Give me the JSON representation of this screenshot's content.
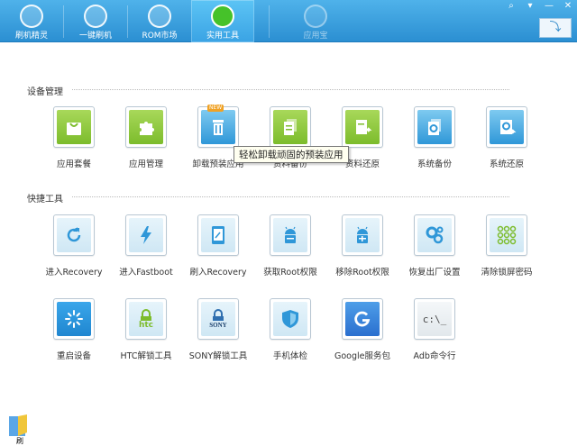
{
  "tabs": [
    {
      "label": "刷机精灵",
      "icon": "flash-sprite-icon"
    },
    {
      "label": "一键刷机",
      "icon": "play-icon"
    },
    {
      "label": "ROM市场",
      "icon": "android-icon"
    },
    {
      "label": "实用工具",
      "icon": "grid-icon"
    },
    {
      "label": "应用宝",
      "icon": "app-store-icon"
    }
  ],
  "window": {
    "btn_feedback": "⌕",
    "btn_menu": "▾",
    "btn_min": "—",
    "btn_close": "✕",
    "btn_back": "⤵"
  },
  "sections": {
    "device": "设备管理",
    "quick": "快捷工具"
  },
  "device_items": [
    {
      "label": "应用套餐"
    },
    {
      "label": "应用管理"
    },
    {
      "label": "卸载预装应用",
      "badge": "NEW"
    },
    {
      "label": "资料备份"
    },
    {
      "label": "资料还原"
    },
    {
      "label": "系统备份"
    },
    {
      "label": "系统还原"
    }
  ],
  "quick_items": [
    {
      "label": "进入Recovery"
    },
    {
      "label": "进入Fastboot"
    },
    {
      "label": "刷入Recovery"
    },
    {
      "label": "获取Root权限"
    },
    {
      "label": "移除Root权限"
    },
    {
      "label": "恢复出厂设置"
    },
    {
      "label": "清除锁屏密码"
    },
    {
      "label": "重启设备"
    },
    {
      "label": "HTC解锁工具"
    },
    {
      "label": "SONY解锁工具"
    },
    {
      "label": "手机体检"
    },
    {
      "label": "Google服务包"
    },
    {
      "label": "Adb命令行"
    }
  ],
  "icon_text": {
    "htc": "htc",
    "sony": "SONY",
    "adb": "c:\\_"
  },
  "tooltip": "轻松卸载顽固的预装应用",
  "desktop_shortcut": {
    "label": "刷"
  }
}
